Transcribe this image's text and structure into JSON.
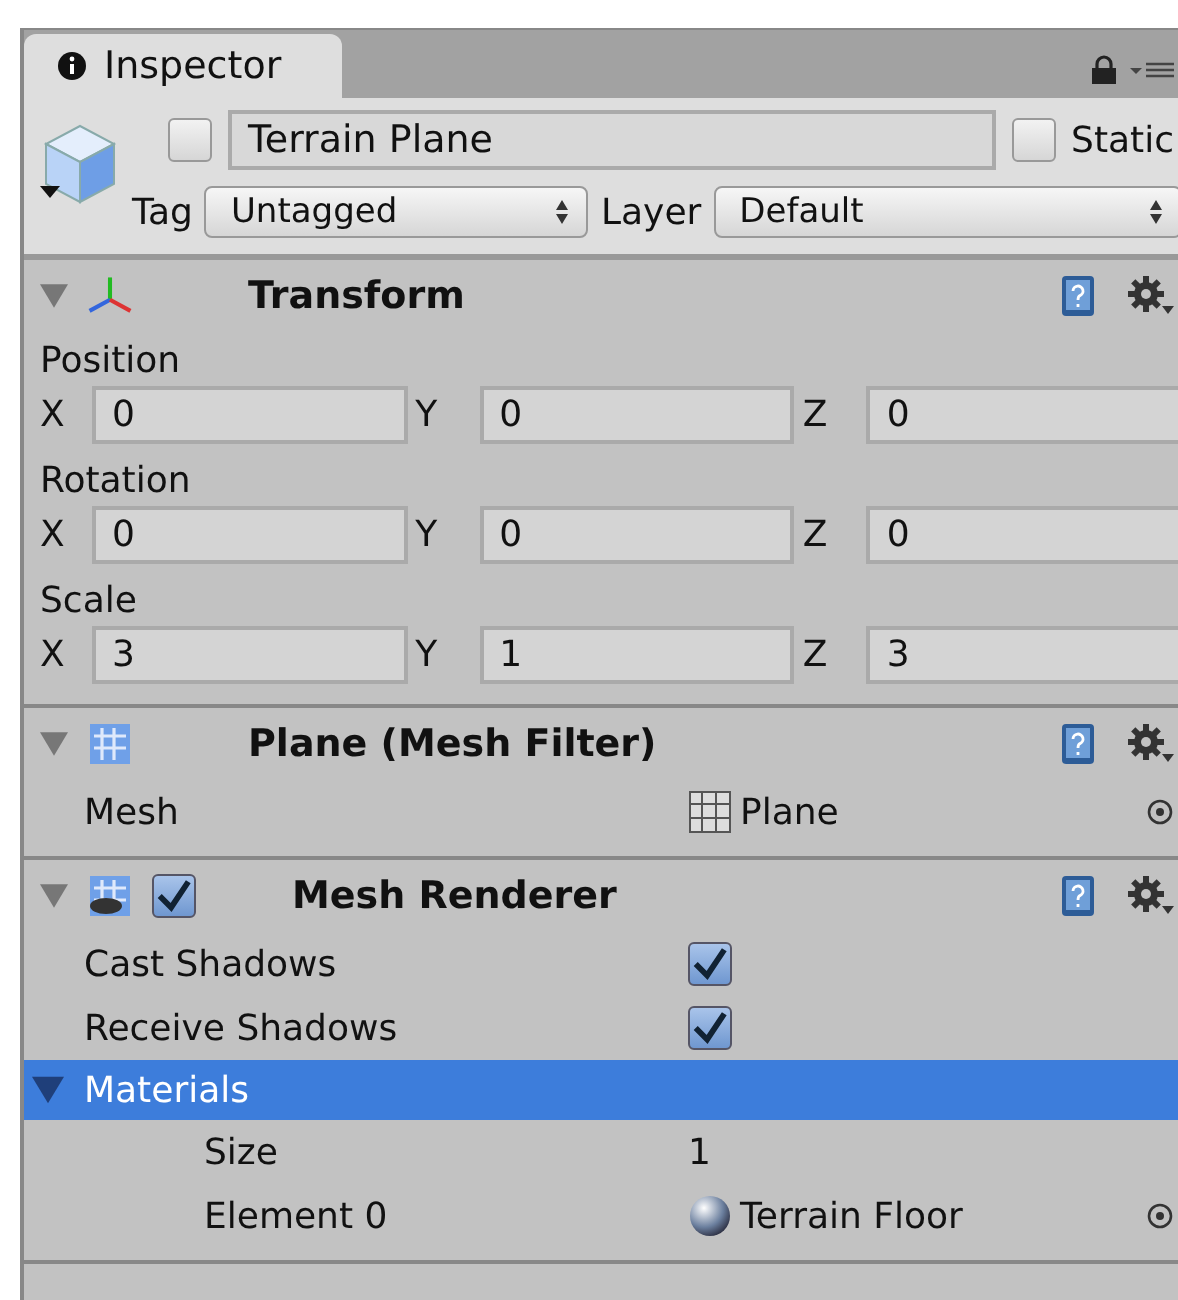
{
  "tab": {
    "title": "Inspector",
    "locked": true
  },
  "object": {
    "active": false,
    "name": "Terrain Plane",
    "static": false,
    "static_label": "Static",
    "tag_label": "Tag",
    "tag": "Untagged",
    "layer_label": "Layer",
    "layer": "Default"
  },
  "components": [
    {
      "kind": "transform",
      "title": "Transform",
      "expanded": true,
      "vectors": [
        {
          "label": "Position",
          "fields": [
            {
              "axis": "X",
              "value": "0"
            },
            {
              "axis": "Y",
              "value": "0"
            },
            {
              "axis": "Z",
              "value": "0"
            }
          ]
        },
        {
          "label": "Rotation",
          "fields": [
            {
              "axis": "X",
              "value": "0"
            },
            {
              "axis": "Y",
              "value": "0"
            },
            {
              "axis": "Z",
              "value": "0"
            }
          ]
        },
        {
          "label": "Scale",
          "fields": [
            {
              "axis": "X",
              "value": "3"
            },
            {
              "axis": "Y",
              "value": "1"
            },
            {
              "axis": "Z",
              "value": "3"
            }
          ]
        }
      ]
    },
    {
      "kind": "mesh_filter",
      "title": "Plane (Mesh Filter)",
      "expanded": true,
      "properties": [
        {
          "kind": "mesh",
          "label": "Mesh",
          "value": "Plane"
        }
      ]
    },
    {
      "kind": "mesh_renderer",
      "title": "Mesh Renderer",
      "expanded": true,
      "enabled": true,
      "properties": [
        {
          "kind": "checkbox",
          "label": "Cast Shadows",
          "checked": true
        },
        {
          "kind": "checkbox",
          "label": "Receive Shadows",
          "checked": true
        },
        {
          "kind": "foldout",
          "label": "Materials",
          "expanded": true,
          "selected": true,
          "children": [
            {
              "kind": "text",
              "label": "Size",
              "value": "1"
            },
            {
              "kind": "material",
              "label": "Element 0",
              "value": "Terrain Floor"
            }
          ]
        }
      ]
    }
  ]
}
